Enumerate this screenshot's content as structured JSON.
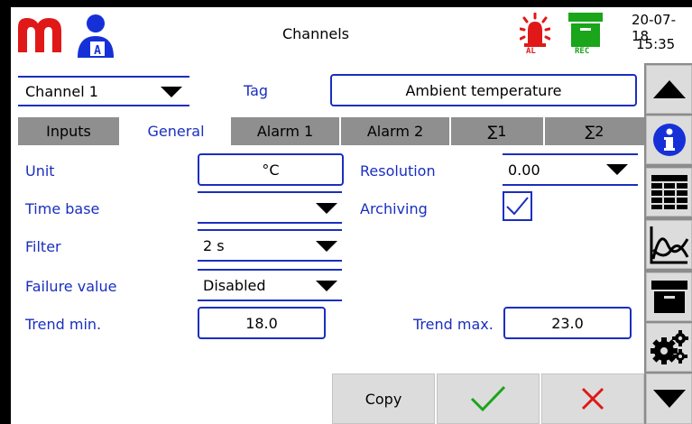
{
  "header": {
    "title": "Channels",
    "date": "20-07-18",
    "time": "15:35",
    "user_badge": "A",
    "alarm_label": "AL",
    "rec_label": "REC",
    "icons": [
      "logo-m-icon",
      "user-icon",
      "alarm-siren-icon",
      "rec-archive-icon"
    ]
  },
  "channel": {
    "selected": "Channel 1",
    "tag_label": "Tag",
    "tag_value": "Ambient temperature"
  },
  "tabs": [
    {
      "label": "Inputs",
      "active": false
    },
    {
      "label": "General",
      "active": true
    },
    {
      "label": "Alarm 1",
      "active": false
    },
    {
      "label": "Alarm 2",
      "active": false
    },
    {
      "label": "∑1",
      "active": false
    },
    {
      "label": "∑2",
      "active": false
    }
  ],
  "form": {
    "unit_label": "Unit",
    "unit_value": "°C",
    "resolution_label": "Resolution",
    "resolution_value": "0.00",
    "timebase_label": "Time base",
    "timebase_value": "",
    "archiving_label": "Archiving",
    "archiving_checked": true,
    "filter_label": "Filter",
    "filter_value": "2 s",
    "failure_label": "Failure value",
    "failure_value": "Disabled",
    "trend_min_label": "Trend min.",
    "trend_min_value": "18.0",
    "trend_max_label": "Trend max.",
    "trend_max_value": "23.0"
  },
  "actions": {
    "copy_label": "Copy"
  },
  "sidebar": {
    "icons": [
      "arrow-up-icon",
      "info-icon",
      "table-icon",
      "chart-icon",
      "archive-icon",
      "settings-gears-icon",
      "arrow-down-icon"
    ]
  },
  "colors": {
    "accent_blue": "#1a2fbf",
    "logo_red": "#e01818",
    "user_blue": "#1630d8",
    "rec_green": "#1aa51a",
    "tab_grey": "#8f8f8f",
    "ok_green": "#1aa51a",
    "cancel_red": "#e01818"
  }
}
